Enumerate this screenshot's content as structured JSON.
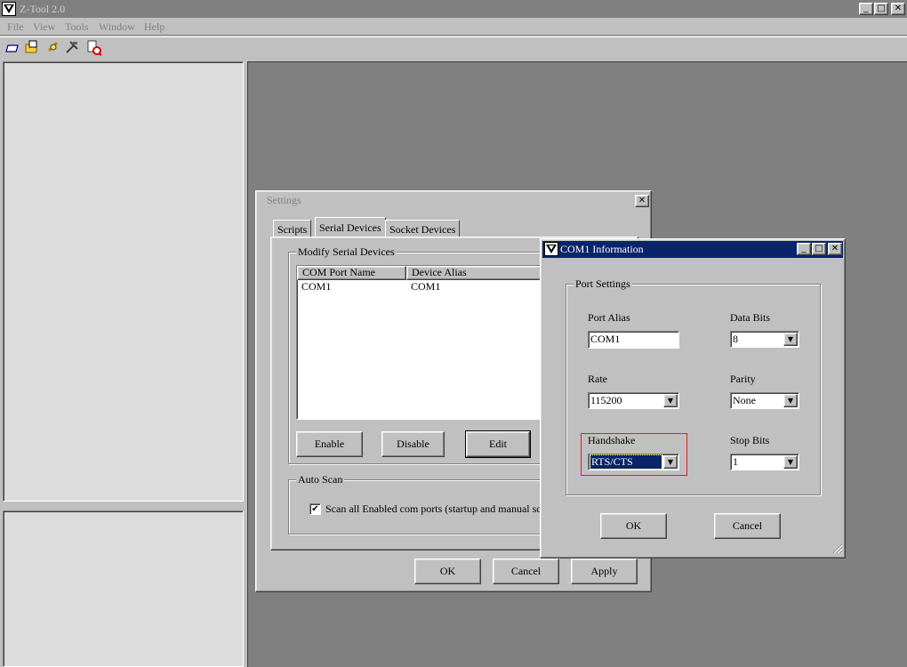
{
  "app": {
    "title": "Z-Tool 2.0",
    "menu": [
      "File",
      "View",
      "Tools",
      "Window",
      "Help"
    ],
    "toolbar_icons": [
      "new-window-icon",
      "open-folder-icon",
      "refresh-icon",
      "tools-icon",
      "search-device-icon"
    ]
  },
  "settings": {
    "title": "Settings",
    "tabs": [
      "Scripts",
      "Serial Devices",
      "Socket Devices"
    ],
    "modify_group": "Modify Serial Devices",
    "columns": [
      "COM Port Name",
      "Device Alias"
    ],
    "rows": [
      [
        "COM1",
        "COM1"
      ]
    ],
    "buttons": {
      "enable": "Enable",
      "disable": "Disable",
      "edit": "Edit"
    },
    "auto_scan_group": "Auto Scan",
    "auto_scan_checkbox": "Scan all Enabled com ports (startup and manual scan",
    "auto_scan_checked": true,
    "footer": {
      "ok": "OK",
      "cancel": "Cancel",
      "apply": "Apply"
    }
  },
  "com_dialog": {
    "title": "COM1 Information",
    "group": "Port Settings",
    "port_alias_label": "Port Alias",
    "port_alias_value": "COM1",
    "data_bits_label": "Data Bits",
    "data_bits_value": "8",
    "rate_label": "Rate",
    "rate_value": "115200",
    "parity_label": "Parity",
    "parity_value": "None",
    "handshake_label": "Handshake",
    "handshake_value": "RTS/CTS",
    "stop_bits_label": "Stop Bits",
    "stop_bits_value": "1",
    "ok": "OK",
    "cancel": "Cancel"
  },
  "colors": {
    "active_title": "#0a246a",
    "inactive_title": "#808080",
    "highlight": "#e02020",
    "mdi_background": "#808080"
  }
}
